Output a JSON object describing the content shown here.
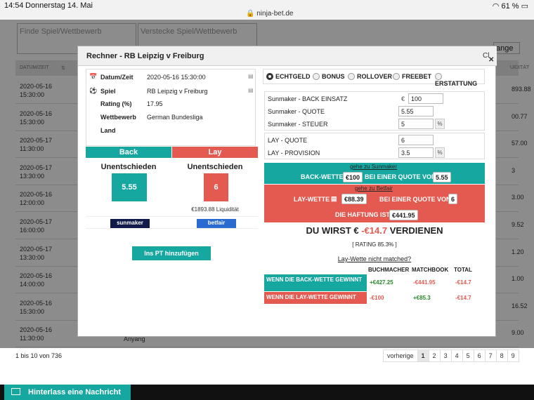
{
  "statusbar": {
    "time": "14:54",
    "date": "Donnerstag 14. Mai",
    "url": "ninja-bet.de",
    "battery": "61 %"
  },
  "filters": {
    "find_placeholder": "Finde Spiel/Wettbewerb",
    "hide_placeholder": "Verstecke Spiel/Wettbewerb",
    "change_label": "ange"
  },
  "table": {
    "col_datetime": "DATUM/ZEIT",
    "col_liquidity": "UIDITÄT",
    "rows": [
      {
        "date": "2020-05-16",
        "time": "15:30:00",
        "right": "893.88"
      },
      {
        "date": "2020-05-16",
        "time": "15:30:00",
        "right": "00.77"
      },
      {
        "date": "2020-05-17",
        "time": "11:30:00",
        "right": "57.00"
      },
      {
        "date": "2020-05-17",
        "time": "13:30:00",
        "right": "3"
      },
      {
        "date": "2020-05-16",
        "time": "12:00:00",
        "right": "3.00"
      },
      {
        "date": "2020-05-17",
        "time": "16:00:00",
        "right": "9.52"
      },
      {
        "date": "2020-05-17",
        "time": "13:30:00",
        "right": "1.20"
      },
      {
        "date": "2020-05-16",
        "time": "14:00:00",
        "right": "1.00"
      },
      {
        "date": "2020-05-16",
        "time": "15:30:00",
        "right": "16.52"
      },
      {
        "date": "2020-05-16",
        "time": "11:30:00",
        "right": "9.00"
      }
    ],
    "row_extra": "Anyang"
  },
  "pager": {
    "info": "1 bis 10 von 736",
    "prev": "vorherige",
    "pages": [
      "1",
      "2",
      "3",
      "4",
      "5",
      "6",
      "7",
      "8",
      "9"
    ]
  },
  "message_button": "Hinterlass eine Nachricht",
  "modal": {
    "title": "Rechner - RB Leipzig v Freiburg",
    "close": "Cl",
    "info": {
      "datetime_label": "Datum/Zeit",
      "datetime_value": "2020-05-16 15:30:00",
      "match_label": "Spiel",
      "match_value": "RB Leipzig v Freiburg",
      "rating_label": "Rating (%)",
      "rating_value": "17.95",
      "competition_label": "Wettbewerb",
      "competition_value": "German Bundesliga",
      "country_label": "Land"
    },
    "back": {
      "header": "Back",
      "outcome": "Unentschieden",
      "odds": "5.55",
      "bookmaker": "sunmaker"
    },
    "lay": {
      "header": "Lay",
      "outcome": "Unentschieden",
      "odds": "6",
      "liquidity": "€1893.88 Liquidität",
      "exchange": "betfair"
    },
    "pt_button": "Ins PT hinzufügen",
    "modes": [
      "ECHTGELD",
      "BONUS",
      "ROLLOVER",
      "FREEBET",
      "ERSTATTUNG"
    ],
    "fields": {
      "stake_label": "Sunmaker - BACK EINSATZ",
      "stake_unit": "€",
      "stake_value": "100",
      "quote_label": "Sunmaker - QUOTE",
      "quote_value": "5.55",
      "tax_label": "Sunmaker - STEUER",
      "tax_value": "5",
      "pct": "%",
      "lay_quote_label": "LAY - QUOTE",
      "lay_quote_value": "6",
      "lay_comm_label": "LAY - PROVISION",
      "lay_comm_value": "3.5"
    },
    "back_band": {
      "link": "gehe zu Sunmaker",
      "label": "BACK-WETTE",
      "stake": "€100",
      "mid": "BEI EINER QUOTE VON",
      "odds": "5.55"
    },
    "lay_band": {
      "link": "gehe zu Betfair",
      "label": "LAY-WETTE",
      "stake": "€88.39",
      "mid": "BEI EINER QUOTE VON",
      "odds": "6",
      "liab_label": "DIE HAFTUNG IST",
      "liab_value": "€441.95"
    },
    "earn": {
      "prefix": "DU WIRST €",
      "amount": "-€14.7",
      "suffix": "VERDIENEN"
    },
    "rating": "[ RATING 85.3% ]",
    "not_matched": "Lay-Wette nicht matched?",
    "results": {
      "h_bookmaker": "BUCHMACHER",
      "h_matchbook": "MATCHBOOK",
      "h_total": "TOTAL",
      "win_back_label": "WENN DIE BACK-WETTE GEWINNT",
      "win_back_book": "+€427.25",
      "win_back_match": "-€441.95",
      "win_back_total": "-€14.7",
      "win_lay_label": "WENN DIE LAY-WETTE GEWINNT",
      "win_lay_book": "-€100",
      "win_lay_match": "+€85.3",
      "win_lay_total": "-€14.7"
    }
  }
}
